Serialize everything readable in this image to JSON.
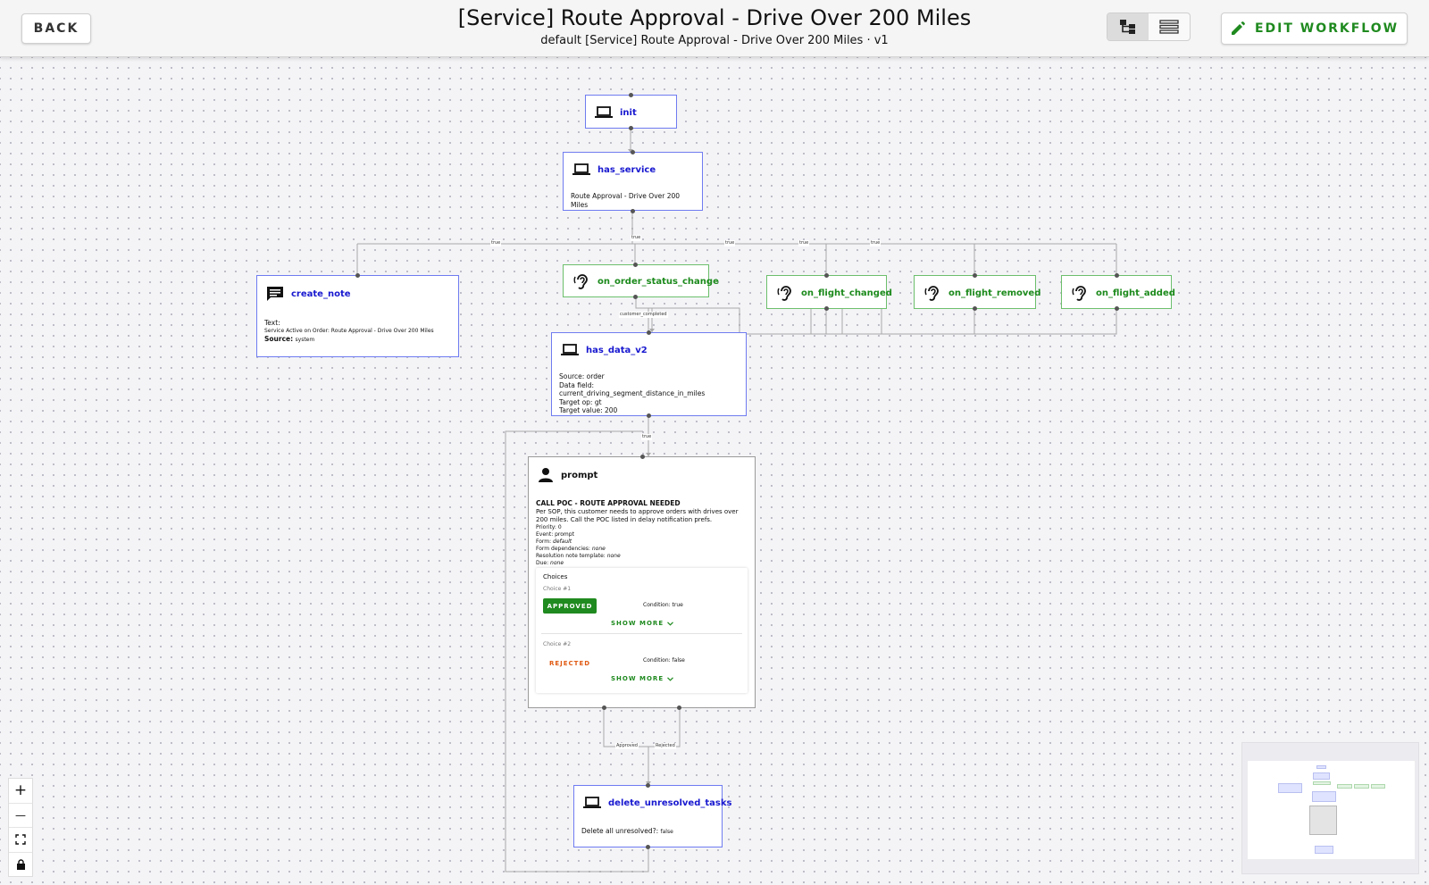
{
  "header": {
    "back_label": "BACK",
    "title": "[Service] Route Approval - Drive Over 200 Miles",
    "subtitle": "default [Service] Route Approval - Drive Over 200 Miles · v1",
    "edit_label": "EDIT WORKFLOW"
  },
  "colors": {
    "system_node": "#6f7cf0",
    "listener_node": "#6cbf6c",
    "accent": "#1f8a1f",
    "rejected": "#e05a12"
  },
  "nodes": {
    "init": {
      "name": "init",
      "icon": "laptop-icon"
    },
    "has_service": {
      "name": "has_service",
      "icon": "laptop-icon",
      "text": "Route Approval - Drive Over 200 Miles"
    },
    "create_note": {
      "name": "create_note",
      "icon": "comment-icon",
      "text_label": "Text:",
      "text_value": "Service Active on Order: Route Approval - Drive Over 200 Miles",
      "source_label": "Source:",
      "source_value": "system"
    },
    "on_order_status_change": {
      "name": "on_order_status_change",
      "icon": "ear-icon"
    },
    "on_flight_changed": {
      "name": "on_flight_changed",
      "icon": "ear-icon"
    },
    "on_flight_removed": {
      "name": "on_flight_removed",
      "icon": "ear-icon"
    },
    "on_flight_added": {
      "name": "on_flight_added",
      "icon": "ear-icon"
    },
    "has_data_v2": {
      "name": "has_data_v2",
      "icon": "laptop-icon",
      "lines": [
        "Source: order",
        "Data field: current_driving_segment_distance_in_miles",
        "Target op: gt",
        "Target value: 200"
      ]
    },
    "prompt": {
      "name": "prompt",
      "icon": "person-icon",
      "heading": "CALL POC - ROUTE APPROVAL NEEDED",
      "description": "Per SOP, this customer needs to approve orders with drives over 200 miles. Call the POC listed in delay notification prefs.",
      "priority": "Priority: 0",
      "event": "Event: prompt",
      "form_label": "Form: ",
      "form_value": "default",
      "form_dependencies_label": "Form dependencies: ",
      "form_dependencies_value": "none",
      "resolution_label": "Resolution note template: ",
      "resolution_value": "none",
      "due_label": "Due: ",
      "due_value": "none",
      "choices_title": "Choices",
      "choice1_label": "Choice #1",
      "choice1_button": "APPROVED",
      "choice1_condition": "Condition: true",
      "choice2_label": "Choice #2",
      "choice2_button": "REJECTED",
      "choice2_condition": "Condition: false",
      "show_more": "SHOW MORE"
    },
    "delete_unresolved_tasks": {
      "name": "delete_unresolved_tasks",
      "icon": "laptop-icon",
      "label": "Delete all unresolved?:",
      "value": "false"
    }
  },
  "edge_labels": {
    "true": "true",
    "customer_completed": "customer_completed",
    "approved": "Approved",
    "rejected": "Rejected"
  },
  "controls": {
    "zoom_in": "+",
    "zoom_out": "—"
  }
}
